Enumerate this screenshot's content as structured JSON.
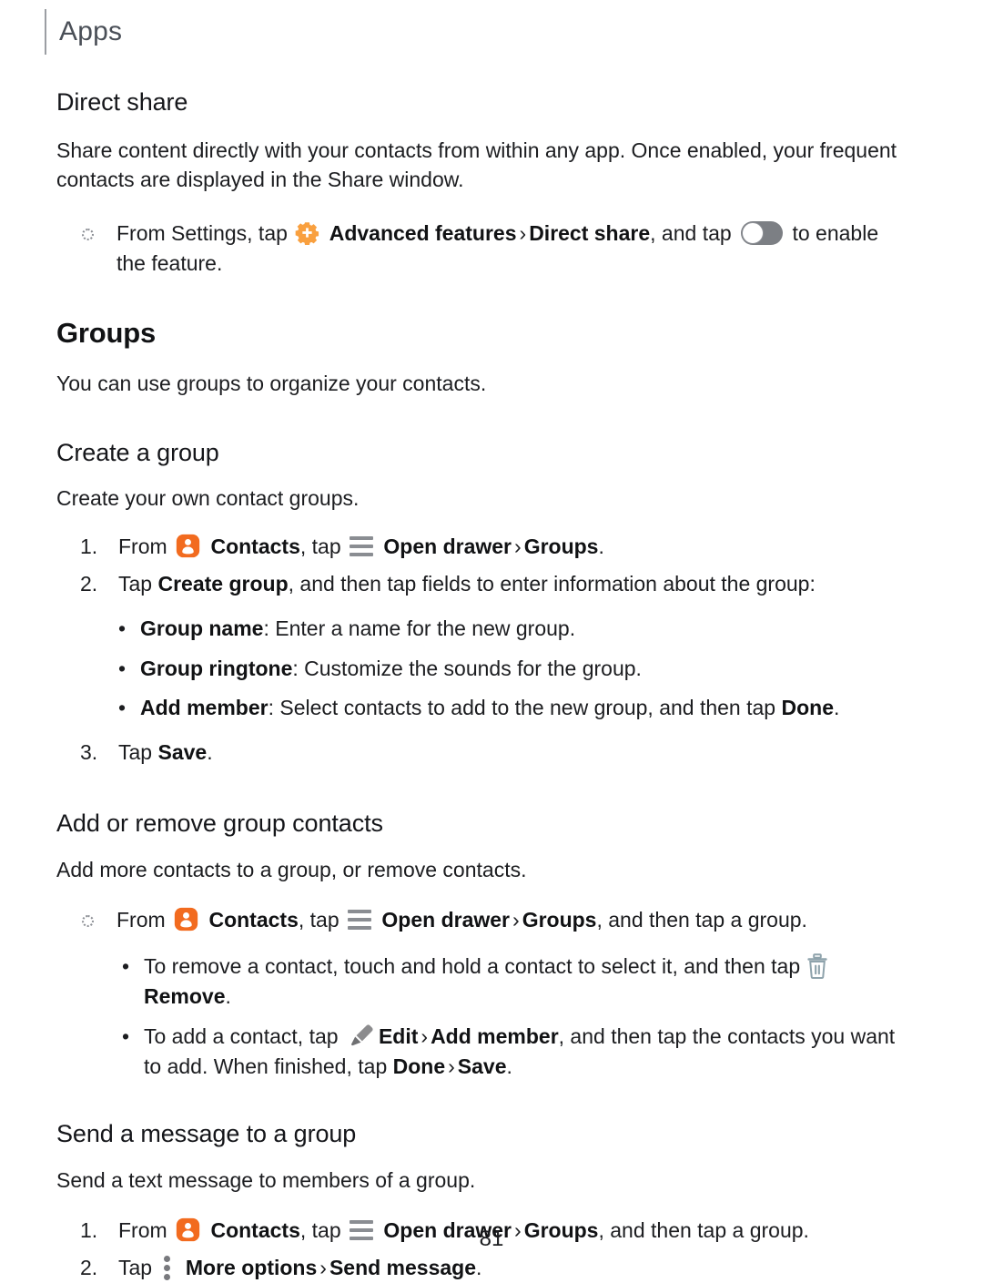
{
  "header": {
    "title": "Apps"
  },
  "direct_share": {
    "heading": "Direct share",
    "intro": "Share content directly with your contacts from within any app. Once enabled, your frequent contacts are displayed in the Share window.",
    "step": {
      "lead": "From Settings, tap",
      "icon": "gear-plus-icon",
      "target1": "Advanced features",
      "chevron": "›",
      "target2": "Direct share",
      "mid": ", and tap",
      "toggle_icon": "toggle-switch-icon",
      "tail": "to enable the feature."
    }
  },
  "groups": {
    "heading": "Groups",
    "intro": "You can use groups to organize your contacts."
  },
  "create_group": {
    "heading": "Create a group",
    "intro": "Create your own contact groups.",
    "steps": [
      {
        "num": "1.",
        "lead": "From",
        "icon": "contacts-icon",
        "app": "Contacts",
        "mid": ", tap",
        "drawer_icon": "open-drawer-icon",
        "target1": "Open drawer",
        "chevron": "›",
        "target2": "Groups",
        "tail": "."
      },
      {
        "num": "2.",
        "lead": "Tap",
        "bold": "Create group",
        "tail": ", and then tap fields to enter information about the group:"
      },
      {
        "num": "3.",
        "lead": "Tap",
        "bold": "Save",
        "tail": "."
      }
    ],
    "fields": [
      {
        "label": "Group name",
        "desc": ": Enter a name for the new group."
      },
      {
        "label": "Group ringtone",
        "desc": ": Customize the sounds for the group."
      },
      {
        "label": "Add member",
        "desc": ": Select contacts to add to the new group, and then tap ",
        "bold_tail": "Done",
        "end": "."
      }
    ]
  },
  "add_remove": {
    "heading": "Add or remove group contacts",
    "intro": "Add more contacts to a group, or remove contacts.",
    "step": {
      "lead": "From",
      "icon": "contacts-icon",
      "app": "Contacts",
      "mid": ", tap",
      "drawer_icon": "open-drawer-icon",
      "target1": "Open drawer",
      "chevron": "›",
      "target2": "Groups",
      "tail": ", and then tap a group."
    },
    "bullets": [
      {
        "lead": "To remove a contact, touch and hold a contact to select it, and then tap",
        "icon": "trash-icon",
        "bold": "Remove",
        "tail": "."
      },
      {
        "lead": "To add a contact, tap",
        "icon": "pencil-icon",
        "bold1": "Edit",
        "chevron": "›",
        "bold2": "Add member",
        "mid": ", and then tap the contacts you want to add. When finished, tap ",
        "bold3": "Done",
        "chevron2": "›",
        "bold4": "Save",
        "end": "."
      }
    ]
  },
  "send_message": {
    "heading": "Send a message to a group",
    "intro": "Send a text message to members of a group.",
    "steps": [
      {
        "num": "1.",
        "lead": "From",
        "icon": "contacts-icon",
        "app": "Contacts",
        "mid": ", tap",
        "drawer_icon": "open-drawer-icon",
        "target1": "Open drawer",
        "chevron": "›",
        "target2": "Groups",
        "tail": ", and then tap a group."
      },
      {
        "num": "2.",
        "lead": "Tap",
        "icon": "more-options-icon",
        "bold1": "More options",
        "chevron": "›",
        "bold2": "Send message",
        "tail": "."
      }
    ]
  },
  "footer": {
    "page_number": "81"
  },
  "colors": {
    "accent_orange": "#F58220",
    "contacts_orange": "#F26B1F",
    "icon_gray": "#8a8d92",
    "trash_slate": "#8FA3AC",
    "rule_gray": "#9b9ea3"
  }
}
